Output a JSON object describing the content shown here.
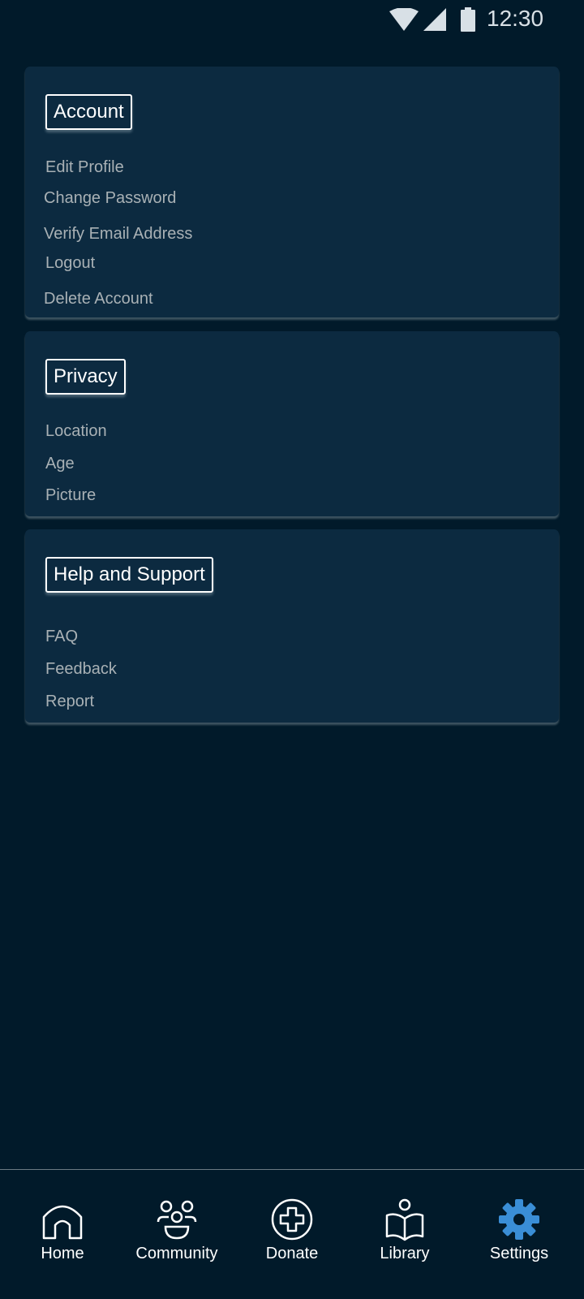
{
  "status_bar": {
    "time": "12:30",
    "icons": [
      "wifi-icon",
      "signal-icon",
      "battery-icon"
    ]
  },
  "sections": {
    "account": {
      "title": "Account",
      "items": [
        "Edit Profile",
        "Change Password",
        "Verify Email Address",
        "Logout",
        "Delete Account"
      ]
    },
    "privacy": {
      "title": "Privacy",
      "items": [
        "Location",
        "Age",
        "Picture"
      ]
    },
    "help": {
      "title": "Help and Support",
      "items": [
        "FAQ",
        "Feedback",
        "Report"
      ]
    }
  },
  "bottom_nav": {
    "items": [
      {
        "label": "Home",
        "icon": "home-icon"
      },
      {
        "label": "Community",
        "icon": "community-icon"
      },
      {
        "label": "Donate",
        "icon": "donate-icon"
      },
      {
        "label": "Library",
        "icon": "library-icon"
      },
      {
        "label": "Settings",
        "icon": "settings-icon",
        "active": true
      }
    ]
  },
  "colors": {
    "background": "#011a2a",
    "card": "#0c2a40",
    "item_text": "#a9b1b5",
    "accent": "#3a8ed6"
  }
}
